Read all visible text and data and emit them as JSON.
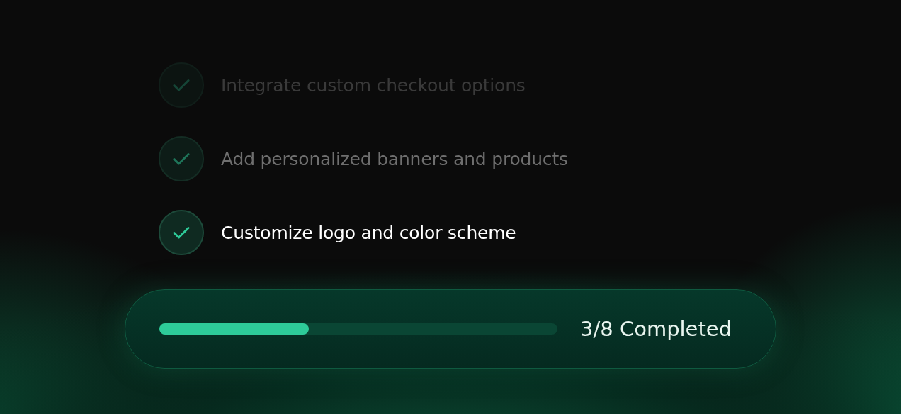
{
  "tasks": [
    {
      "label": "Integrate custom checkout options",
      "kind": "faded"
    },
    {
      "label": "Add personalized banners and products",
      "kind": "dim"
    },
    {
      "label": "Customize logo and color scheme",
      "kind": "active"
    }
  ],
  "progress": {
    "level": 0.375,
    "label": "3/8 Completed"
  }
}
